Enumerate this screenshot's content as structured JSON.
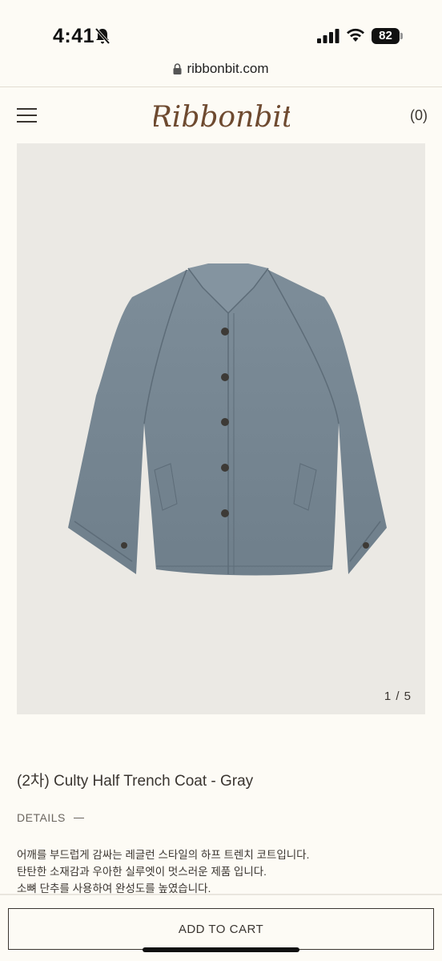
{
  "status_bar": {
    "time": "4:41",
    "battery": "82"
  },
  "browser": {
    "url": "ribbonbit.com"
  },
  "header": {
    "logo": "Ribbonbit",
    "cart_count": "(0)"
  },
  "gallery": {
    "counter": "1 / 5"
  },
  "product": {
    "title": "(2차) Culty Half Trench Coat - Gray",
    "details_label": "DETAILS",
    "description": [
      "어깨를 부드럽게 감싸는 레글런 스타일의 하프 트렌치 코트입니다.",
      "탄탄한 소재감과 우아한 실루엣이 멋스러운 제품 입니다.",
      "소뼈 단추를 사용하여 완성도를 높였습니다."
    ]
  },
  "footer": {
    "add_to_cart": "ADD TO CART"
  },
  "colors": {
    "background": "#fdfbf5",
    "text": "#3a3530",
    "logo": "#6e4a30",
    "coat": "#7a8a96"
  }
}
